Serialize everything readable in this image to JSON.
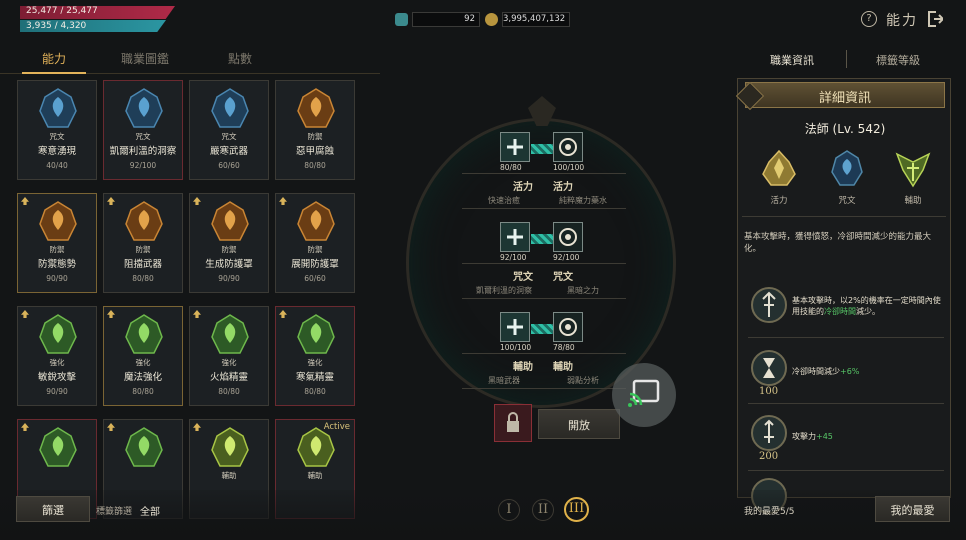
{
  "hp": "25,477 / 25,477",
  "mp": "3,935 / 4,320",
  "currency": {
    "gems": "92",
    "gold": "3,995,407,132"
  },
  "header": {
    "title": "能力"
  },
  "tabs": [
    "能力",
    "職業圖鑑",
    "點數"
  ],
  "right_tabs": [
    "職業資訊",
    "標籤等級"
  ],
  "cards": [
    {
      "cat": "咒文",
      "name": "寒意湧現",
      "count": "40/40",
      "type": "blue",
      "border": "dark"
    },
    {
      "cat": "咒文",
      "name": "凱爾利溫的洞察",
      "count": "92/100",
      "type": "blue",
      "border": "red"
    },
    {
      "cat": "咒文",
      "name": "嚴寒武器",
      "count": "60/60",
      "type": "blue",
      "border": "dark"
    },
    {
      "cat": "防禦",
      "name": "惡甲腐蝕",
      "count": "80/80",
      "type": "orange",
      "border": "dark"
    },
    {
      "cat": "防禦",
      "name": "防禦態勢",
      "count": "90/90",
      "type": "orange",
      "border": "gold",
      "up": true
    },
    {
      "cat": "防禦",
      "name": "阻擋武器",
      "count": "80/80",
      "type": "orange",
      "border": "dark",
      "up": true
    },
    {
      "cat": "防禦",
      "name": "生成防護罩",
      "count": "90/90",
      "type": "orange",
      "border": "dark",
      "up": true
    },
    {
      "cat": "防禦",
      "name": "展開防護罩",
      "count": "60/60",
      "type": "orange",
      "border": "dark",
      "up": true
    },
    {
      "cat": "強化",
      "name": "敏銳攻擊",
      "count": "90/90",
      "type": "green",
      "border": "dark",
      "up": true
    },
    {
      "cat": "強化",
      "name": "魔法強化",
      "count": "80/80",
      "type": "green",
      "border": "gold",
      "up": true
    },
    {
      "cat": "強化",
      "name": "火焰精靈",
      "count": "80/80",
      "type": "green",
      "border": "dark",
      "up": true
    },
    {
      "cat": "強化",
      "name": "寒氣精靈",
      "count": "80/80",
      "type": "green",
      "border": "red",
      "up": true
    },
    {
      "cat": "",
      "name": "",
      "count": "",
      "type": "green",
      "border": "red",
      "up": true
    },
    {
      "cat": "",
      "name": "",
      "count": "",
      "type": "green",
      "border": "dark",
      "up": true
    },
    {
      "cat": "輔助",
      "name": "",
      "count": "",
      "type": "lime",
      "border": "dark",
      "up": true
    },
    {
      "cat": "輔助",
      "name": "",
      "count": "",
      "type": "lime",
      "border": "red",
      "active": "Active"
    }
  ],
  "slots": [
    {
      "left_val": "80/80",
      "right_val": "100/100",
      "left_label": "活力",
      "right_label": "活力",
      "sub": "快速治癒",
      "sub2": "純粹魔力藥水"
    },
    {
      "left_val": "92/100",
      "right_val": "92/100",
      "left_label": "咒文",
      "right_label": "咒文",
      "sub": "凱爾利溫的洞察",
      "sub2": "黑暗之力"
    },
    {
      "left_val": "100/100",
      "right_val": "78/80",
      "left_label": "輔助",
      "right_label": "輔助",
      "sub": "黑暗武器",
      "sub2": "弱點分析"
    }
  ],
  "open_button": "開放",
  "detail": {
    "title": "詳細資訊",
    "class_name": "法師 (Lv. 542)",
    "emblems": [
      "活力",
      "咒文",
      "輔助"
    ],
    "description": "基本攻擊時，獲得憤怒，冷卻時間減少的能力最大化。",
    "skills": [
      {
        "text1": "基本攻擊時，以2%的機率在一定時間內使用技能的",
        "hl": "冷卻時間",
        "text2": "減少。",
        "num": ""
      },
      {
        "text1": "冷卻時間減少",
        "hl": "+6%",
        "text2": "",
        "num": "100"
      },
      {
        "text1": "攻擊力",
        "hl": "+45",
        "text2": "",
        "num": "200"
      }
    ]
  },
  "bottom": {
    "filter_button": "篩選",
    "tag_filter_label": "標籤篩選",
    "tag_filter_value": "全部",
    "pages": [
      "I",
      "II",
      "III"
    ],
    "favorites_count": "我的最愛5/5",
    "favorites_button": "我的最愛"
  }
}
